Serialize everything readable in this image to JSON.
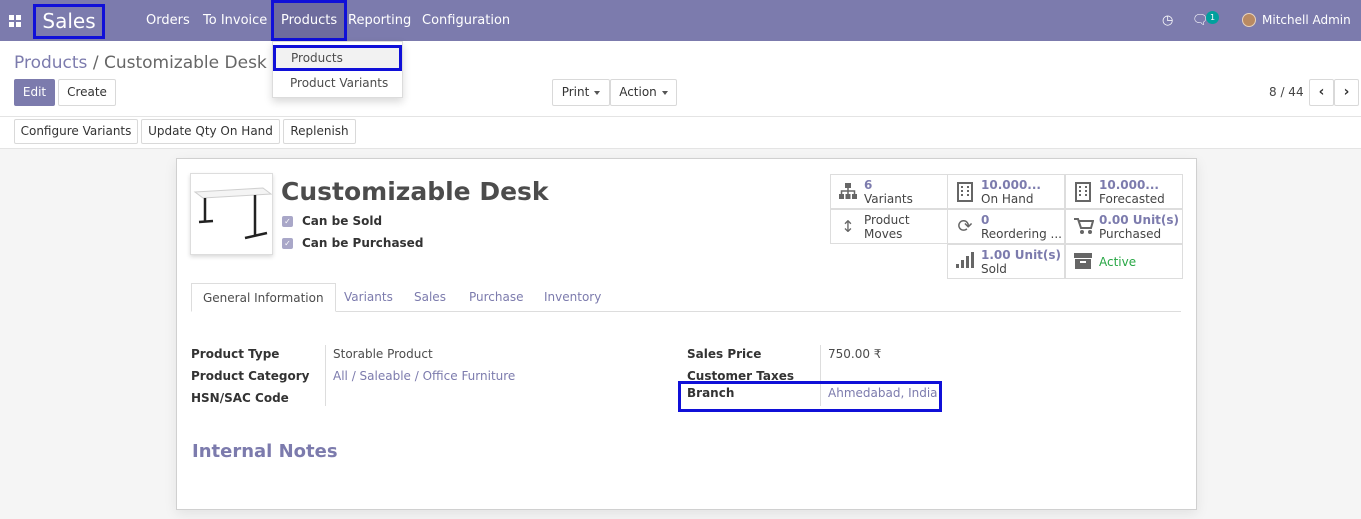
{
  "navbar": {
    "app_name": "Sales",
    "menus": [
      "Orders",
      "To Invoice",
      "Products",
      "Reporting",
      "Configuration"
    ],
    "user_name": "Mitchell Admin",
    "messages_count": "1"
  },
  "dropdown": {
    "items": [
      "Products",
      "Product Variants"
    ]
  },
  "breadcrumb": {
    "parent": "Products",
    "separator": "/",
    "current": "Customizable Desk"
  },
  "buttons": {
    "edit": "Edit",
    "create": "Create",
    "print": "Print",
    "action": "Action",
    "pager": "8 / 44",
    "configure_variants": "Configure Variants",
    "update_qty": "Update Qty On Hand",
    "replenish": "Replenish"
  },
  "product": {
    "name": "Customizable Desk",
    "can_be_sold": "Can be Sold",
    "can_be_purchased": "Can be Purchased"
  },
  "smart_buttons": [
    {
      "value": "6",
      "label": "Variants",
      "icon": "sitemap-icon"
    },
    {
      "value": "10.000...",
      "label": "On Hand",
      "icon": "building-icon"
    },
    {
      "value": "10.000...",
      "label": "Forecasted",
      "icon": "building-icon"
    },
    {
      "value": "Product",
      "label": "Moves",
      "icon": "arrows-v-icon"
    },
    {
      "value": "0",
      "label": "Reordering ...",
      "icon": "refresh-icon"
    },
    {
      "value": "0.00 Unit(s)",
      "label": "Purchased",
      "icon": "cart-icon"
    },
    {
      "value": "1.00 Unit(s)",
      "label": "Sold",
      "icon": "signal-icon"
    },
    {
      "value": "Active",
      "label": "",
      "icon": "archive-icon"
    }
  ],
  "tabs": [
    "General Information",
    "Variants",
    "Sales",
    "Purchase",
    "Inventory"
  ],
  "fields": {
    "product_type_label": "Product Type",
    "product_type_value": "Storable Product",
    "product_category_label": "Product Category",
    "product_category_value": "All / Saleable / Office Furniture",
    "hsn_label": "HSN/SAC Code",
    "sales_price_label": "Sales Price",
    "sales_price_value": "750.00 ₹",
    "customer_taxes_label": "Customer Taxes",
    "branch_label": "Branch",
    "branch_value": "Ahmedabad, India"
  },
  "internal_notes_label": "Internal Notes",
  "colors": {
    "brand": "#7c7bad",
    "highlight_box": "#1010d8",
    "active_green": "#28a745"
  }
}
